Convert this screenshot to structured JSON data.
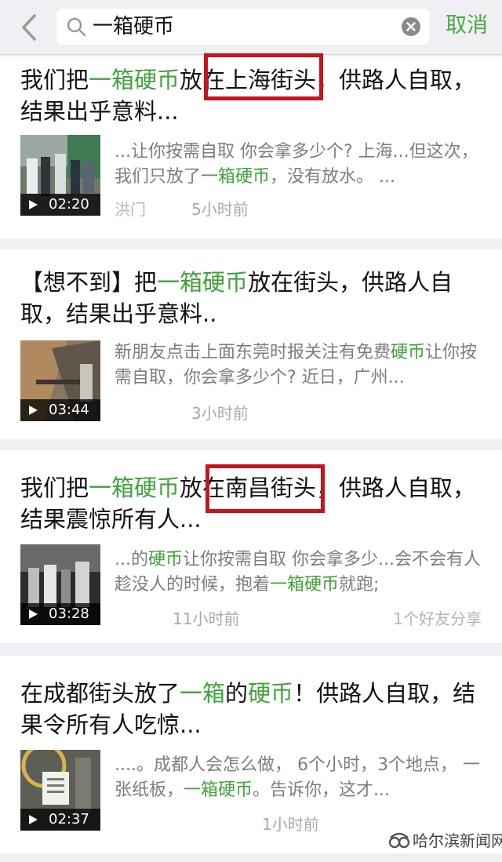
{
  "header": {
    "search_query": "一箱硬币",
    "cancel_label": "取消",
    "icons": [
      "chevron-left-icon",
      "search-icon",
      "clear-icon"
    ]
  },
  "results": [
    {
      "title": [
        {
          "text": "我们把",
          "hl": false
        },
        {
          "text": "一箱硬币",
          "hl": true
        },
        {
          "text": "放在上海街头，供路人自取，结果出乎意料...",
          "hl": false
        }
      ],
      "snippet": [
        {
          "text": "...让你按需自取 你会拿多少个? 上海...但这次，我们只放了",
          "hl": false
        },
        {
          "text": "一箱硬币",
          "hl": true
        },
        {
          "text": "，没有放水。 ...",
          "hl": false
        }
      ],
      "duration": "02:20",
      "source": "洪门",
      "time": "5小时前",
      "friend_share": ""
    },
    {
      "title": [
        {
          "text": "【想不到】把",
          "hl": false
        },
        {
          "text": "一箱硬币",
          "hl": true
        },
        {
          "text": "放在街头，供路人自取，结果出乎意料..",
          "hl": false
        }
      ],
      "snippet": [
        {
          "text": "新朋友点击上面东莞时报关注有免费",
          "hl": false
        },
        {
          "text": "硬币",
          "hl": true
        },
        {
          "text": "让你按需自取，你会拿多少个? 近日，广州...",
          "hl": false
        }
      ],
      "duration": "03:44",
      "source": "",
      "time": "3小时前",
      "friend_share": ""
    },
    {
      "title": [
        {
          "text": "我们把",
          "hl": false
        },
        {
          "text": "一箱硬币",
          "hl": true
        },
        {
          "text": "放在南昌街头，供路人自取，结果震惊所有人...",
          "hl": false
        }
      ],
      "snippet": [
        {
          "text": "...的",
          "hl": false
        },
        {
          "text": "硬币",
          "hl": true
        },
        {
          "text": "让你按需自取 你会拿多少...会不会有人趁没人的时候，抱着",
          "hl": false
        },
        {
          "text": "一箱硬币",
          "hl": true
        },
        {
          "text": "就跑;",
          "hl": false
        }
      ],
      "duration": "03:28",
      "source": "",
      "time": "11小时前",
      "friend_share": "1个好友分享"
    },
    {
      "title": [
        {
          "text": "在成都街头放了",
          "hl": false
        },
        {
          "text": "一箱",
          "hl": true
        },
        {
          "text": "的",
          "hl": false
        },
        {
          "text": "硬币",
          "hl": true
        },
        {
          "text": "！供路人自取，结果令所有人吃惊...",
          "hl": false
        }
      ],
      "snippet": [
        {
          "text": "....。成都人会怎么做， 6个小时，3个地点， 一张纸板，",
          "hl": false
        },
        {
          "text": "一箱硬币",
          "hl": true
        },
        {
          "text": "。告诉你，这才...",
          "hl": false
        }
      ],
      "duration": "02:37",
      "source": "",
      "time": "1小时前",
      "friend_share": ""
    }
  ],
  "watermark": {
    "text": "哈尔滨新闻网",
    "icon": "wechat-channel-icon"
  },
  "colors": {
    "highlight": "#3fa33a",
    "cancel": "#4aaa3e",
    "annotation_box": "#c4151c",
    "background": "#efeff4"
  }
}
